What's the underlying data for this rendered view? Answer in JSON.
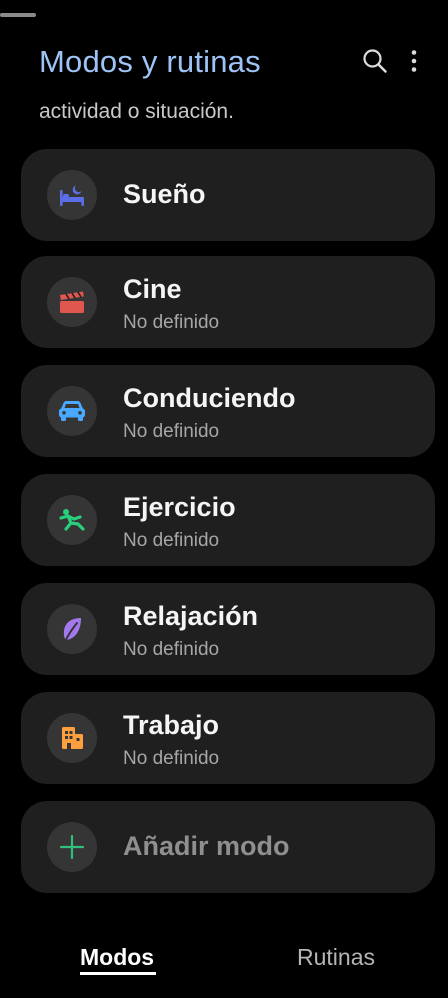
{
  "header": {
    "title": "Modos y rutinas",
    "search_icon": "search-icon",
    "more_icon": "more-vert-icon"
  },
  "subtitle": "actividad o situación.",
  "modes": [
    {
      "label": "Sueño",
      "status": "",
      "icon": "bed-icon",
      "color": "#5b6ee8"
    },
    {
      "label": "Cine",
      "status": "No definido",
      "icon": "clapperboard-icon",
      "color": "#e0574f"
    },
    {
      "label": "Conduciendo",
      "status": "No definido",
      "icon": "car-icon",
      "color": "#4aa9ff"
    },
    {
      "label": "Ejercicio",
      "status": "No definido",
      "icon": "running-icon",
      "color": "#27d07a"
    },
    {
      "label": "Relajación",
      "status": "No definido",
      "icon": "leaf-icon",
      "color": "#a479f0"
    },
    {
      "label": "Trabajo",
      "status": "No definido",
      "icon": "building-icon",
      "color": "#ff9f3d"
    }
  ],
  "add_mode": {
    "label": "Añadir modo",
    "icon": "plus-icon",
    "color": "#2fbf7a"
  },
  "bottom_nav": {
    "tabs": [
      {
        "label": "Modos",
        "active": true
      },
      {
        "label": "Rutinas",
        "active": false
      }
    ]
  }
}
